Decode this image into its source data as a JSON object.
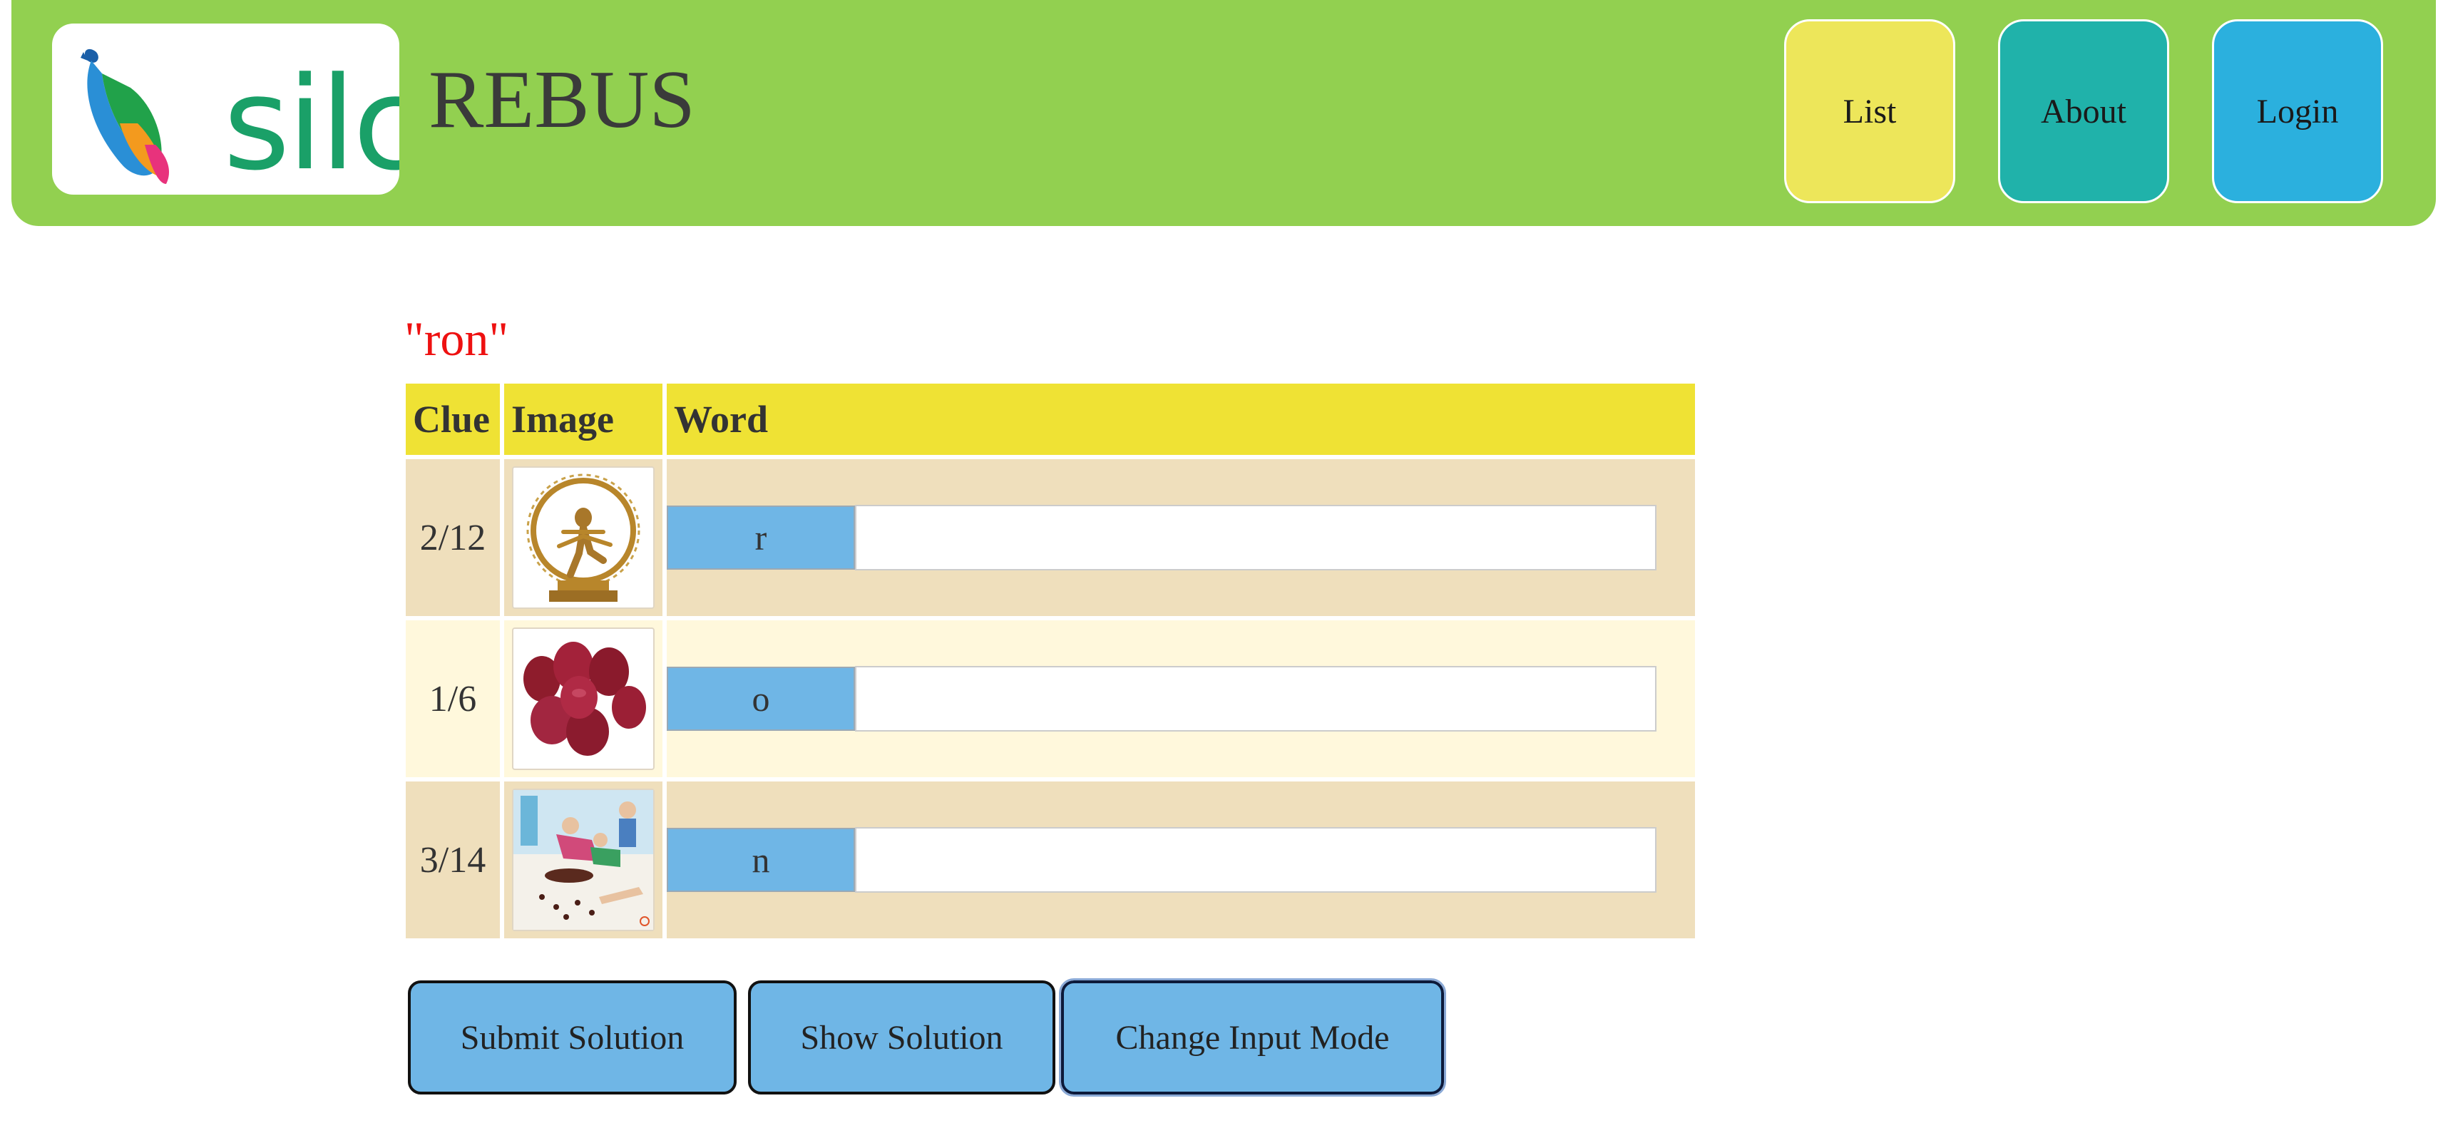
{
  "header": {
    "brand": "silc",
    "title": "REBUS",
    "nav": [
      {
        "label": "List"
      },
      {
        "label": "About"
      },
      {
        "label": "Login"
      }
    ]
  },
  "puzzle": {
    "word": "\"ron\"",
    "columns": [
      "Clue",
      "Image",
      "Word"
    ],
    "rows": [
      {
        "clue": "2/12",
        "image": "nataraja-statue",
        "letter": "r",
        "input_value": ""
      },
      {
        "clue": "1/6",
        "image": "red-onions",
        "letter": "o",
        "input_value": ""
      },
      {
        "clue": "3/14",
        "image": "children-cartoon",
        "letter": "n",
        "input_value": ""
      }
    ]
  },
  "actions": {
    "submit": "Submit Solution",
    "show": "Show Solution",
    "change": "Change Input Mode"
  },
  "colors": {
    "header_bg": "#92d050",
    "list_btn": "#ede65a",
    "about_btn": "#20b2aa",
    "login_btn": "#2bb0de",
    "table_header": "#efe234",
    "row_tan": "#efdfbc",
    "row_cream": "#fff8dc",
    "letter_bg": "#6fb6e6",
    "puzzle_word": "#ee1111"
  }
}
